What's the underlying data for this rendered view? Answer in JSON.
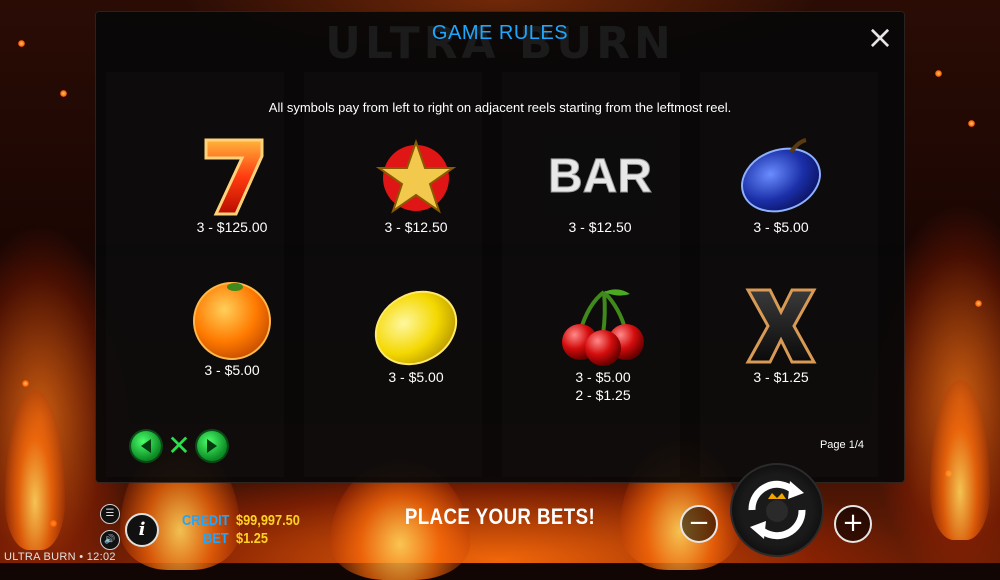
{
  "background": {
    "ghost_title": "ULTRA BURN"
  },
  "panel": {
    "title": "GAME RULES",
    "close_label": "×",
    "intro": "All symbols pay from left to right on adjacent reels starting from the leftmost reel.",
    "symbols": [
      {
        "icon": "seven-icon",
        "pays": [
          "3 - $125.00"
        ]
      },
      {
        "icon": "star-icon",
        "pays": [
          "3 - $12.50"
        ]
      },
      {
        "icon": "bar-icon",
        "label": "BAR",
        "pays": [
          "3 - $12.50"
        ]
      },
      {
        "icon": "plum-icon",
        "pays": [
          "3 - $5.00"
        ]
      },
      {
        "icon": "orange-icon",
        "pays": [
          "3 - $5.00"
        ]
      },
      {
        "icon": "lemon-icon",
        "pays": [
          "3 - $5.00"
        ]
      },
      {
        "icon": "cherries-icon",
        "pays": [
          "3 - $5.00",
          "2 - $1.25"
        ]
      },
      {
        "icon": "x-icon",
        "pays": [
          "3 - $1.25"
        ]
      }
    ],
    "nav": {
      "prev_icon": "arrow-left-icon",
      "close_icon": "close-x-icon",
      "next_icon": "arrow-right-icon",
      "close_glyph": "✕"
    },
    "page_indicator": "Page 1/4"
  },
  "bottom": {
    "credit_label": "CREDIT",
    "credit_value": "$99,997.50",
    "bet_label": "BET",
    "bet_value": "$1.25",
    "message": "PLACE YOUR BETS!",
    "minus": "−",
    "plus": "+",
    "menu_glyph": "☰",
    "sound_glyph": "🔊",
    "info_glyph": "i"
  },
  "footer": {
    "game_name": "ULTRA BURN",
    "separator": "•",
    "time": "12:02"
  },
  "colors": {
    "accent_blue": "#1ea7ff",
    "value_yellow": "#ffd21f",
    "nav_green": "#29e04a"
  }
}
